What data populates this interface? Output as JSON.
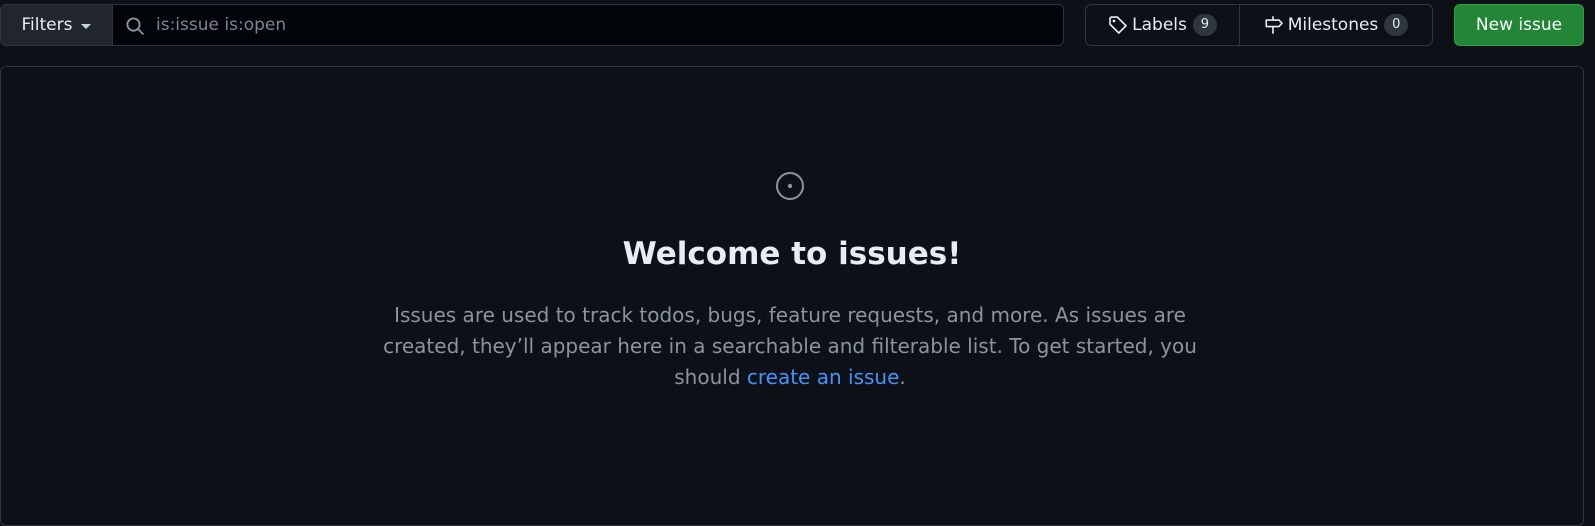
{
  "toolbar": {
    "filters_label": "Filters",
    "search_placeholder": "is:issue is:open",
    "labels": {
      "label": "Labels",
      "count": "9"
    },
    "milestones": {
      "label": "Milestones",
      "count": "0"
    },
    "new_issue_label": "New issue"
  },
  "empty_state": {
    "icon": "issue-opened-icon",
    "title": "Welcome to issues!",
    "description": "Issues are used to track todos, bugs, feature requests, and more. As issues are created, they’ll appear here in a searchable and filterable list. To get started, you should ",
    "link_text": "create an issue",
    "trailing": "."
  },
  "colors": {
    "background": "#0d1117",
    "border": "#30363d",
    "primary_button": "#238636",
    "link": "#4493f8",
    "muted_text": "#8b949e"
  }
}
